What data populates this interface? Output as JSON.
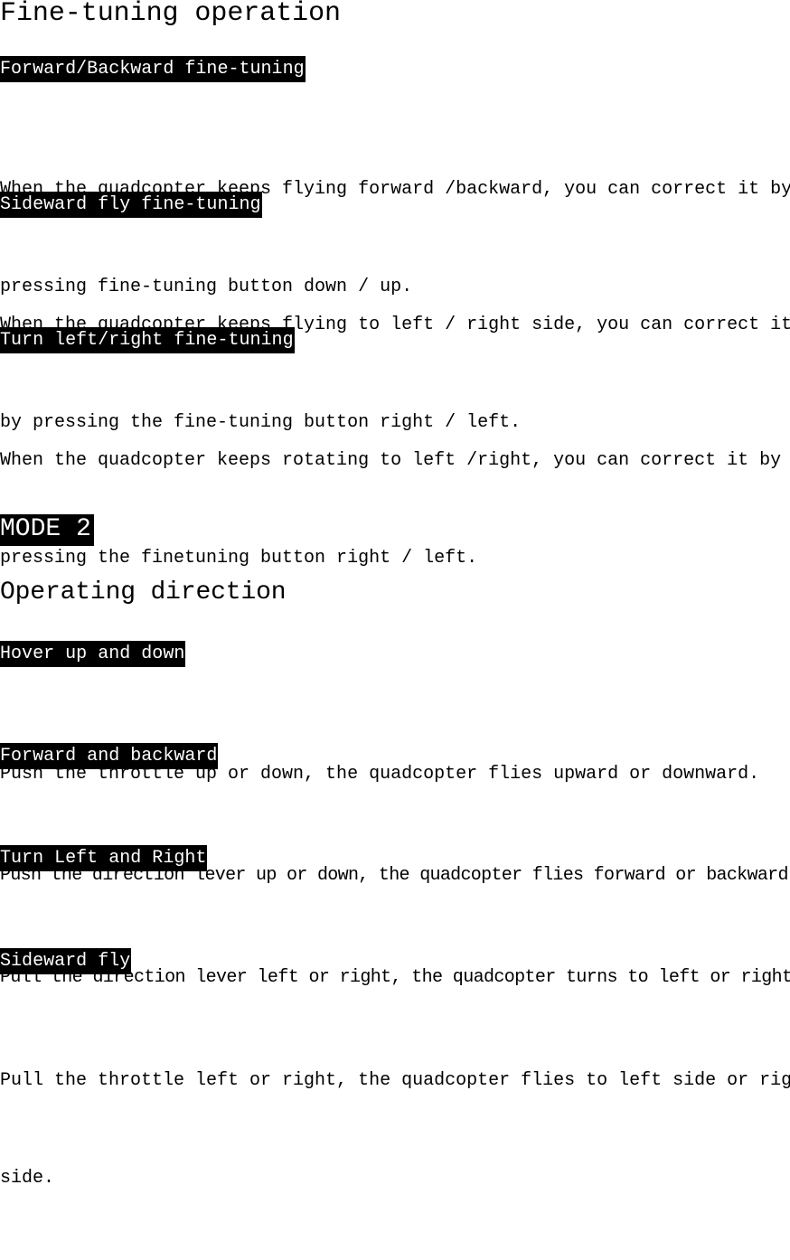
{
  "document": {
    "title": "Fine-tuning operation",
    "background_color": "#ffffff",
    "text_color": "#000000",
    "highlight_color": "#000000",
    "highlight_text_color": "#ffffff"
  },
  "sections": {
    "fine_tuning": {
      "heading_1": "Forward/Backward fine-tuning",
      "para_1_line_1": "When the quadcopter keeps flying forward /backward, you can correct it by",
      "para_1_line_2": "pressing fine-tuning button down / up.",
      "heading_2": "Sideward fly fine-tuning",
      "para_2_line_1": "When the quadcopter keeps flying to left / right side, you can correct it",
      "para_2_line_2": "by pressing the fine-tuning button right / left.",
      "heading_3": "Turn left/right fine-tuning",
      "para_3_line_1": "When the quadcopter keeps rotating to left /right, you can correct it by",
      "para_3_line_2": "pressing the finetuning button right / left."
    },
    "mode_2": {
      "mode_label": "MODE 2",
      "sub_title": "Operating direction",
      "heading_1": "Hover up and down",
      "para_1_line_1": "Push the throttle up or down, the quadcopter flies upward or downward.",
      "heading_2": "Forward and backward",
      "para_2_line_1": "Push the direction lever up or down, the quadcopter flies forward or backward.",
      "heading_3": "Turn Left and Right",
      "para_3_line_1": "Pull the direction lever left or right, the quadcopter turns to left or right.",
      "heading_4": "Sideward fly",
      "para_4_line_1": "Pull the throttle left or right, the quadcopter flies to left side or right",
      "para_4_line_2": "side."
    }
  }
}
